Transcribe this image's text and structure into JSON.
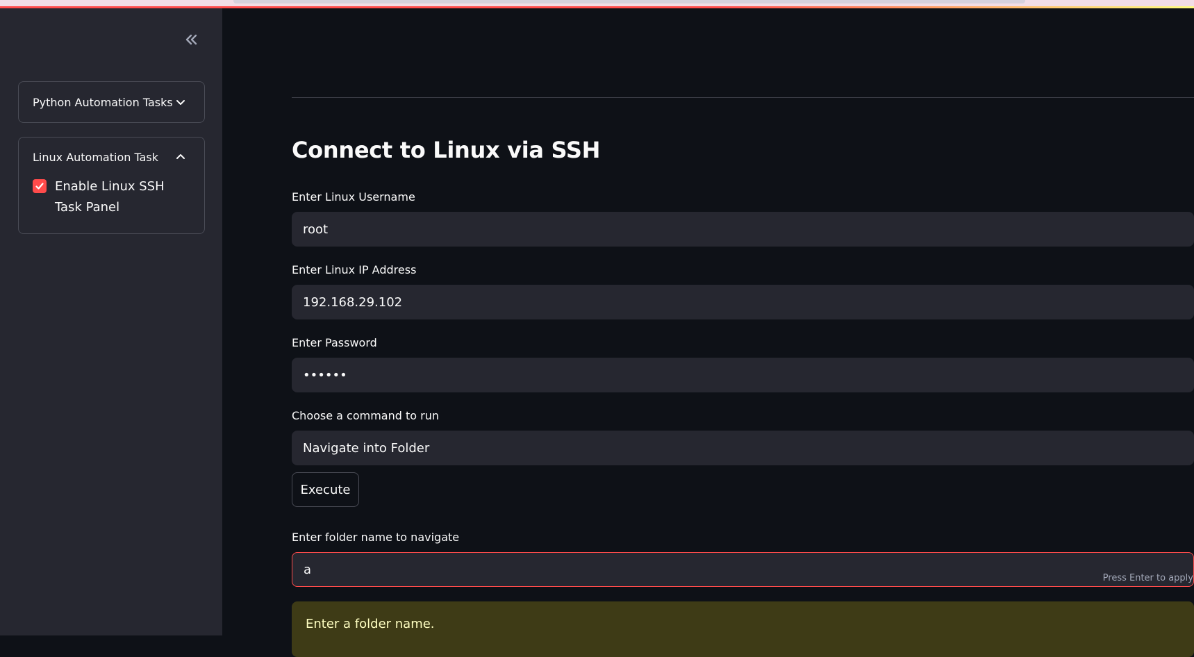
{
  "sidebar": {
    "collapse_icon": "double-chevron-left-icon",
    "expanders": [
      {
        "label": "Python Automation Tasks",
        "expanded": false,
        "icon": "chevron-down-icon"
      },
      {
        "label": "Linux Automation Task",
        "expanded": true,
        "icon": "chevron-up-icon",
        "checkbox": {
          "label": "Enable Linux SSH Task Panel",
          "checked": true
        }
      }
    ]
  },
  "main": {
    "title": "Connect to Linux via SSH",
    "fields": {
      "username": {
        "label": "Enter Linux Username",
        "value": "root"
      },
      "ip": {
        "label": "Enter Linux IP Address",
        "value": "192.168.29.102"
      },
      "password": {
        "label": "Enter Password",
        "value": "••••••"
      },
      "command": {
        "label": "Choose a command to run",
        "value": "Navigate into Folder"
      },
      "folder": {
        "label": "Enter folder name to navigate",
        "value": "a",
        "hint": "Press Enter to apply"
      }
    },
    "execute_label": "Execute",
    "warning": "Enter a folder name."
  },
  "colors": {
    "accent": "#ff4b4b",
    "sidebar_bg": "#262730",
    "main_bg": "#0e1117",
    "warning_bg": "#3e3b16",
    "warning_text": "#ffffc2"
  }
}
